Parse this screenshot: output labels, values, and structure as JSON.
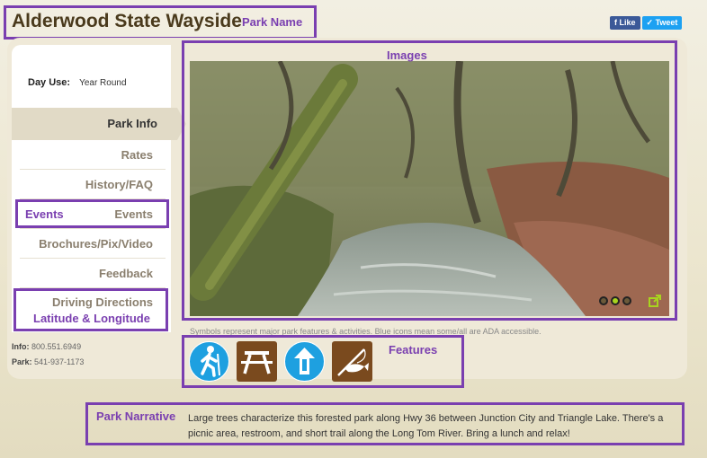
{
  "header": {
    "park_name": "Alderwood State Wayside",
    "social": {
      "like": "Like",
      "tweet": "Tweet"
    }
  },
  "annotations": {
    "park_name": "Park Name",
    "images": "Images",
    "events": "Events",
    "lat_long": "Latitude & Longitude",
    "features": "Features",
    "park_narrative": "Park Narrative"
  },
  "sidebar": {
    "day_use_label": "Day Use:",
    "day_use_value": "Year Round",
    "items": [
      {
        "label": "Park Info",
        "active": true
      },
      {
        "label": "Rates"
      },
      {
        "label": "History/FAQ"
      },
      {
        "label": "Events"
      },
      {
        "label": "Brochures/Pix/Video"
      },
      {
        "label": "Feedback"
      },
      {
        "label": "Driving Directions"
      }
    ]
  },
  "contact": {
    "info_label": "Info:",
    "info_phone": "800.551.6949",
    "park_label": "Park:",
    "park_phone": "541-937-1173"
  },
  "slideshow": {
    "dots": 3,
    "active_dot": 1
  },
  "features": {
    "caption": "Symbols represent major park features & activities. Blue icons mean some/all are ADA accessible.",
    "icons": [
      {
        "name": "hiking-icon",
        "color": "#1ea0e0"
      },
      {
        "name": "picnic-table-icon",
        "color": "#7a4a1e"
      },
      {
        "name": "restroom-icon",
        "color": "#1ea0e0"
      },
      {
        "name": "fishing-icon",
        "color": "#7a4a1e"
      }
    ]
  },
  "narrative": "Large trees characterize this forested park along Hwy 36 between Junction City and Triangle Lake. There's a picnic area, restroom, and short trail along the Long Tom River. Bring a lunch and relax!"
}
